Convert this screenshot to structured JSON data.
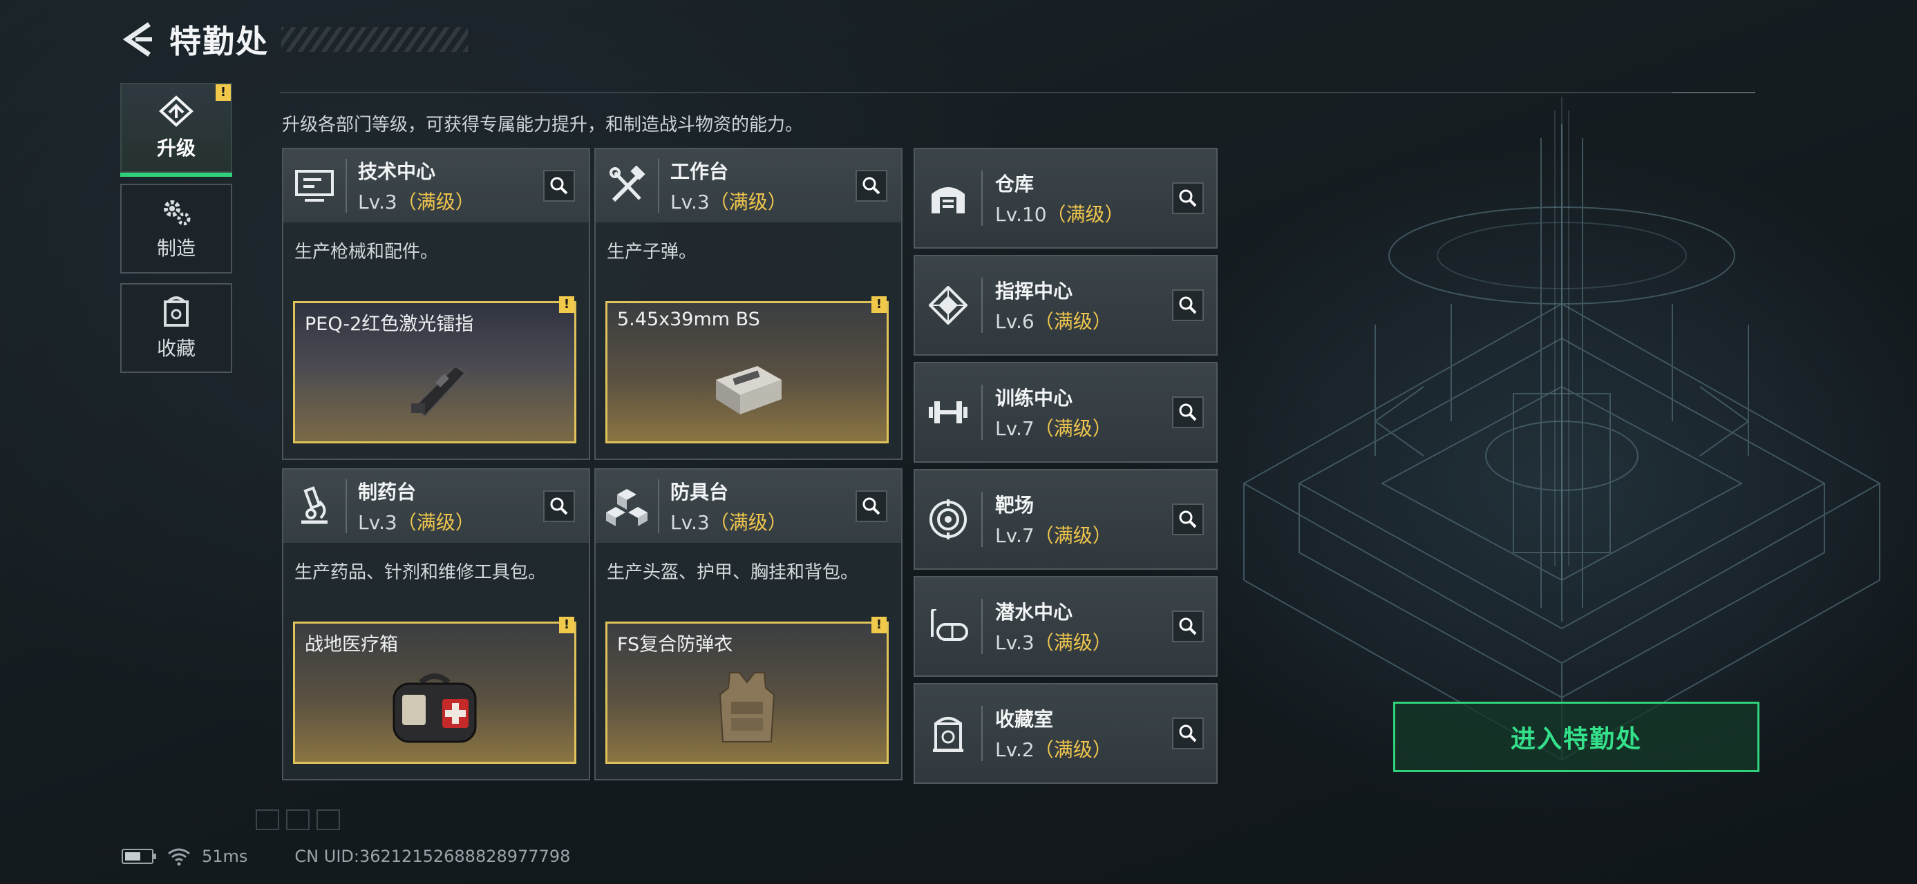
{
  "header": {
    "title": "特勤处"
  },
  "side_tabs": [
    {
      "label": "升级",
      "active": true,
      "warning": "!"
    },
    {
      "label": "制造"
    },
    {
      "label": "收藏"
    }
  ],
  "intro": "升级各部门等级，可获得专属能力提升，和制造战斗物资的能力。",
  "cards": [
    {
      "name": "技术中心",
      "level": "Lv.3",
      "level_tag": "（满级）",
      "desc": "生产枪械和配件。",
      "product": "PEQ-2红色激光镭指",
      "product_warning": "!"
    },
    {
      "name": "工作台",
      "level": "Lv.3",
      "level_tag": "（满级）",
      "desc": "生产子弹。",
      "product": "5.45x39mm BS",
      "product_warning": "!"
    },
    {
      "name": "制药台",
      "level": "Lv.3",
      "level_tag": "（满级）",
      "desc": "生产药品、针剂和维修工具包。",
      "product": "战地医疗箱",
      "product_warning": "!"
    },
    {
      "name": "防具台",
      "level": "Lv.3",
      "level_tag": "（满级）",
      "desc": "生产头盔、护甲、胸挂和背包。",
      "product": "FS复合防弹衣",
      "product_warning": "!"
    }
  ],
  "list": [
    {
      "name": "仓库",
      "level": "Lv.10",
      "level_tag": "（满级）",
      "icon": "warehouse-icon"
    },
    {
      "name": "指挥中心",
      "level": "Lv.6",
      "level_tag": "（满级）",
      "icon": "command-center-icon"
    },
    {
      "name": "训练中心",
      "level": "Lv.7",
      "level_tag": "（满级）",
      "icon": "dumbbell-icon"
    },
    {
      "name": "靶场",
      "level": "Lv.7",
      "level_tag": "（满级）",
      "icon": "target-icon"
    },
    {
      "name": "潜水中心",
      "level": "Lv.3",
      "level_tag": "（满级）",
      "icon": "diving-mask-icon"
    },
    {
      "name": "收藏室",
      "level": "Lv.2",
      "level_tag": "（满级）",
      "icon": "collection-room-icon"
    }
  ],
  "enter_button": "进入特勤处",
  "status": {
    "ping": "51ms",
    "uid": "CN UID:3621215268882897​7798"
  },
  "colors": {
    "accent_green": "#2fd27b",
    "max_level": "#f0c64d",
    "warning": "#f0c84a"
  }
}
